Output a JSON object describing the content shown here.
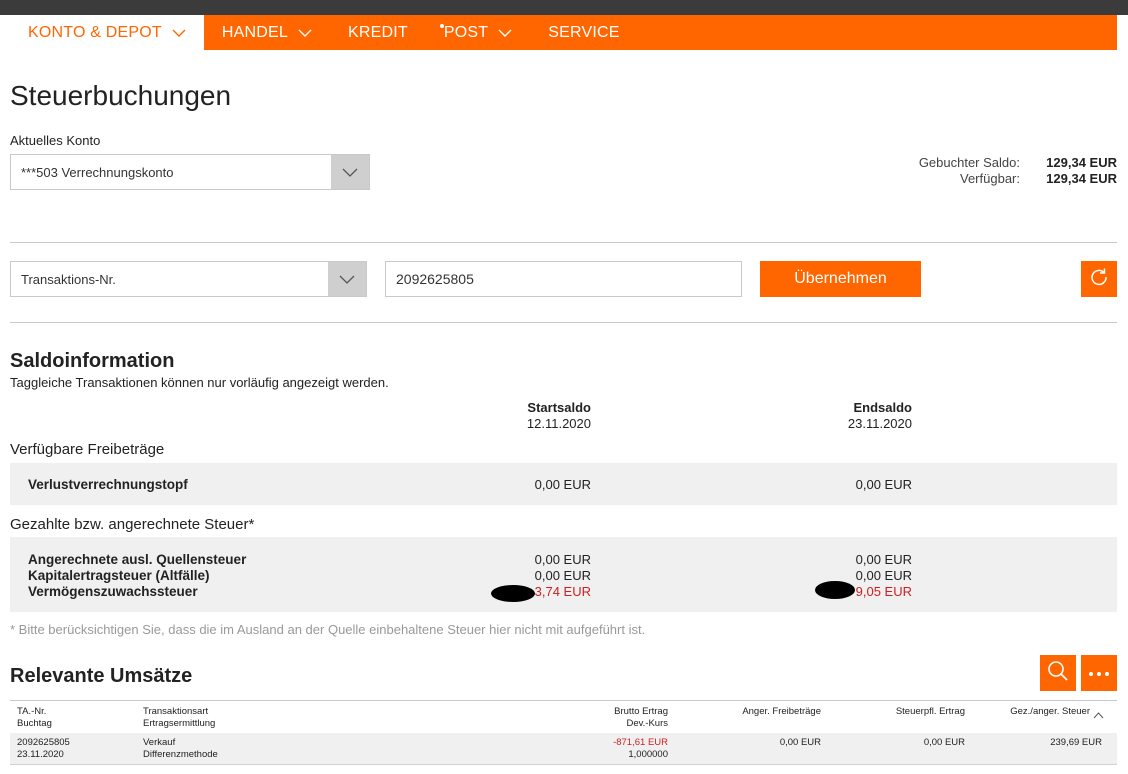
{
  "nav": {
    "items": [
      {
        "label": "KONTO & DEPOT",
        "active": true,
        "dropdown": true
      },
      {
        "label": "HANDEL",
        "active": false,
        "dropdown": true
      },
      {
        "label": "KREDIT",
        "active": false,
        "dropdown": false
      },
      {
        "label": "POST",
        "active": false,
        "dropdown": true,
        "dot": true
      },
      {
        "label": "SERVICE",
        "active": false,
        "dropdown": false
      }
    ],
    "accent": "#ff6600"
  },
  "page": {
    "title": "Steuerbuchungen",
    "konto_label": "Aktuelles Konto",
    "konto_value": "***503 Verrechnungskonto"
  },
  "saldo": {
    "gebucht_label": "Gebuchter Saldo:",
    "gebucht_value": "129,34 EUR",
    "verfuegbar_label": "Verfügbar:",
    "verfuegbar_value": "129,34 EUR"
  },
  "filter": {
    "type_value": "Transaktions-Nr.",
    "input_value": "2092625805",
    "apply_label": "Übernehmen"
  },
  "saldoinfo": {
    "heading": "Saldoinformation",
    "subtitle": "Taggleiche Transaktionen können nur vorläufig angezeigt werden.",
    "start_label": "Startsaldo",
    "start_date": "12.11.2020",
    "end_label": "Endsaldo",
    "end_date": "23.11.2020",
    "freibetraege_label": "Verfügbare Freibeträge",
    "verlust_label": "Verlustverrechnungstopf",
    "verlust_start": "0,00 EUR",
    "verlust_end": "0,00 EUR",
    "steuer_label": "Gezahlte bzw. angerechnete Steuer*",
    "rows": [
      {
        "label": "Angerechnete ausl. Quellensteuer",
        "start": "0,00 EUR",
        "end": "0,00 EUR"
      },
      {
        "label": "Kapitalertragsteuer (Altfälle)",
        "start": "0,00 EUR",
        "end": "0,00 EUR"
      },
      {
        "label": "Vermögenszuwachssteuer",
        "start": "3,74 EUR",
        "end": "9,05 EUR"
      }
    ],
    "note": "* Bitte berücksichtigen Sie, dass die im Ausland an der Quelle einbehaltene Steuer hier nicht mit aufgeführt ist."
  },
  "umsaetze": {
    "heading": "Relevante Umsätze",
    "headers": {
      "ta_nr": "TA.-Nr.",
      "buchtag": "Buchtag",
      "art": "Transaktionsart",
      "ermittlung": "Ertragsermittlung",
      "brutto": "Brutto Ertrag",
      "kurs": "Dev.-Kurs",
      "freibetraege": "Anger. Freibeträge",
      "steuerpfl": "Steuerpfl. Ertrag",
      "gez": "Gez./anger. Steuer"
    },
    "row": {
      "ta_nr": "2092625805",
      "buchtag": "23.11.2020",
      "art": "Verkauf",
      "ermittlung": "Differenzmethode",
      "brutto": "-871,61 EUR",
      "kurs": "1,000000",
      "freibetraege": "0,00 EUR",
      "steuerpfl": "0,00 EUR",
      "gez": "239,69 EUR"
    }
  }
}
